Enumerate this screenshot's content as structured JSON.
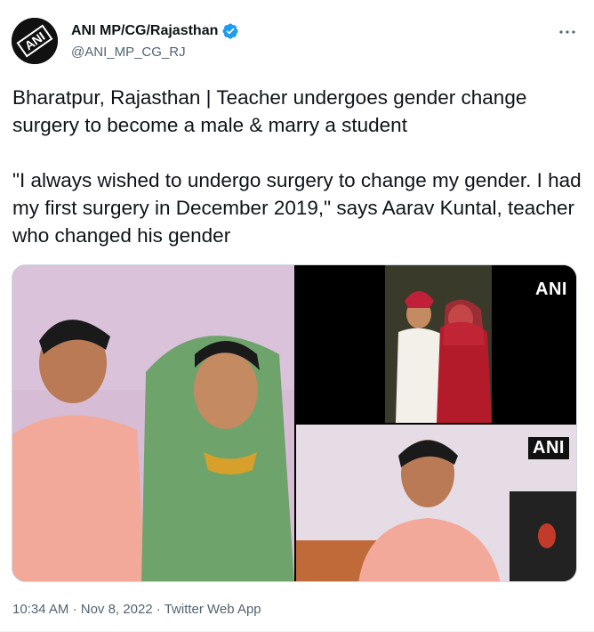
{
  "author": {
    "display_name": "ANI MP/CG/Rajasthan",
    "handle": "@ANI_MP_CG_RJ",
    "avatar_text": "ANI",
    "verified": true,
    "verified_color": "#1d9bf0"
  },
  "tweet": {
    "text": "Bharatpur, Rajasthan | Teacher undergoes gender change surgery to become a male & marry a student\n\n\"I always wished to undergo surgery to change my gender. I had my first surgery in December 2019,\" says Aarav Kuntal, teacher who changed his gender"
  },
  "media": {
    "watermark_top_right": "ANI",
    "watermark_bottom_right": "ANI",
    "photos": [
      {
        "description_icon": "couple-photo"
      },
      {
        "description_icon": "wedding-photo"
      },
      {
        "description_icon": "interview-photo"
      }
    ]
  },
  "meta": {
    "time": "10:34 AM",
    "separator": "·",
    "date": "Nov 8, 2022",
    "source": "Twitter Web App"
  },
  "icons": {
    "more": "more-horizontal-icon",
    "verified": "verified-badge-icon"
  },
  "colors": {
    "text_primary": "#0f1419",
    "text_secondary": "#536471",
    "border": "#cfd9de"
  }
}
